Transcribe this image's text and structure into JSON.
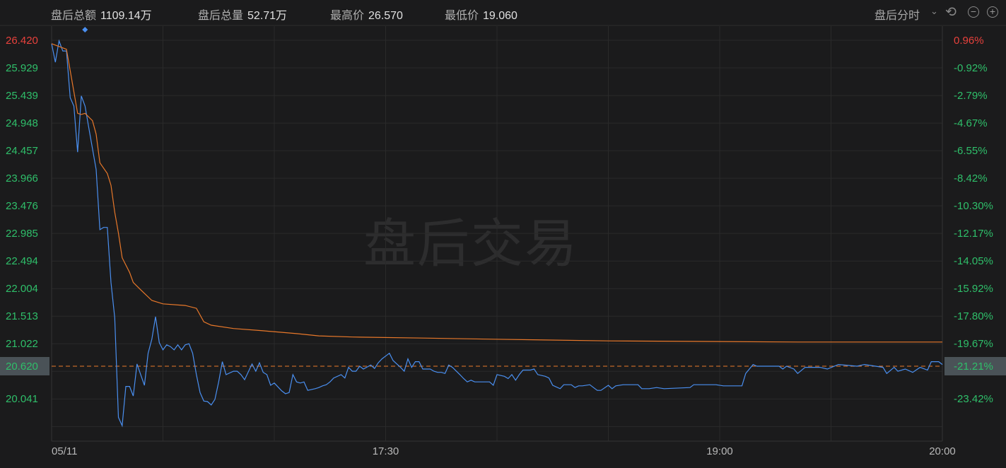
{
  "header": {
    "stats": [
      {
        "label": "盘后总额",
        "value": "1109.14万"
      },
      {
        "label": "盘后总量",
        "value": "52.71万"
      },
      {
        "label": "最高价",
        "value": "26.570"
      },
      {
        "label": "最低价",
        "value": "19.060"
      }
    ],
    "mode": "盘后分时",
    "icons": [
      "chevron-down-icon",
      "undo-icon",
      "zoom-out-icon",
      "zoom-in-icon"
    ]
  },
  "watermark": "盘后交易",
  "colors": {
    "price": "#4a8ff0",
    "avg": "#e8782a",
    "up": "#e8413c",
    "down": "#2fbf6a",
    "ref": "#e8782a"
  },
  "chart_data": {
    "type": "line",
    "title": "盘后分时",
    "xlabel": "",
    "ylabel": "",
    "x_unit": "minutes since 16:00",
    "xlim": [
      0,
      240
    ],
    "ylim": [
      19.286,
      26.672
    ],
    "grid": true,
    "x_ticks": [
      {
        "minute": 0,
        "label": "05/11"
      },
      {
        "minute": 90,
        "label": "17:30"
      },
      {
        "minute": 180,
        "label": "19:00"
      },
      {
        "minute": 240,
        "label": "20:00"
      }
    ],
    "y_ticks_left": [
      "26.420",
      "25.929",
      "25.439",
      "24.948",
      "24.457",
      "23.966",
      "23.476",
      "22.985",
      "22.494",
      "22.004",
      "21.513",
      "21.022",
      "20.620",
      "20.041"
    ],
    "y_ticks_left_values": [
      26.42,
      25.929,
      25.439,
      24.948,
      24.457,
      23.966,
      23.476,
      22.985,
      22.494,
      22.004,
      21.513,
      21.022,
      20.62,
      20.041
    ],
    "y_ticks_right": [
      "0.96%",
      "-0.92%",
      "-2.79%",
      "-4.67%",
      "-6.55%",
      "-8.42%",
      "-10.30%",
      "-12.17%",
      "-14.05%",
      "-15.92%",
      "-17.80%",
      "-19.67%",
      "-21.21%",
      "-23.42%"
    ],
    "reference_price": 20.62,
    "series": [
      {
        "name": "price",
        "points": [
          [
            0,
            26.36
          ],
          [
            1,
            26.03
          ],
          [
            2,
            26.41
          ],
          [
            3,
            26.23
          ],
          [
            4,
            26.23
          ],
          [
            5,
            25.4
          ],
          [
            6,
            25.25
          ],
          [
            7,
            24.43
          ],
          [
            8,
            25.43
          ],
          [
            9,
            25.25
          ],
          [
            10,
            24.87
          ],
          [
            12,
            24.12
          ],
          [
            13,
            23.05
          ],
          [
            14,
            23.09
          ],
          [
            15,
            23.09
          ],
          [
            16,
            22.11
          ],
          [
            17,
            21.48
          ],
          [
            18,
            19.71
          ],
          [
            19,
            19.56
          ],
          [
            20,
            20.26
          ],
          [
            21,
            20.26
          ],
          [
            22,
            20.09
          ],
          [
            23,
            20.66
          ],
          [
            24,
            20.47
          ],
          [
            25,
            20.28
          ],
          [
            26,
            20.85
          ],
          [
            27,
            21.1
          ],
          [
            28,
            21.5
          ],
          [
            29,
            21.04
          ],
          [
            30,
            20.91
          ],
          [
            31,
            21.0
          ],
          [
            32,
            20.97
          ],
          [
            33,
            20.91
          ],
          [
            34,
            21.0
          ],
          [
            35,
            20.91
          ],
          [
            36,
            21.0
          ],
          [
            37,
            21.02
          ],
          [
            38,
            20.85
          ],
          [
            39,
            20.47
          ],
          [
            40,
            20.15
          ],
          [
            41,
            20.0
          ],
          [
            42,
            19.99
          ],
          [
            43,
            19.93
          ],
          [
            44,
            20.03
          ],
          [
            45,
            20.34
          ],
          [
            46,
            20.7
          ],
          [
            47,
            20.47
          ],
          [
            49,
            20.53
          ],
          [
            50,
            20.53
          ],
          [
            51,
            20.47
          ],
          [
            52,
            20.38
          ],
          [
            54,
            20.66
          ],
          [
            55,
            20.53
          ],
          [
            56,
            20.68
          ],
          [
            57,
            20.51
          ],
          [
            58,
            20.47
          ],
          [
            59,
            20.28
          ],
          [
            60,
            20.32
          ],
          [
            62,
            20.18
          ],
          [
            63,
            20.13
          ],
          [
            64,
            20.15
          ],
          [
            65,
            20.47
          ],
          [
            66,
            20.34
          ],
          [
            67,
            20.32
          ],
          [
            68,
            20.34
          ],
          [
            69,
            20.19
          ],
          [
            71,
            20.22
          ],
          [
            72,
            20.24
          ],
          [
            73,
            20.27
          ],
          [
            74,
            20.29
          ],
          [
            75,
            20.34
          ],
          [
            76,
            20.41
          ],
          [
            78,
            20.47
          ],
          [
            79,
            20.41
          ],
          [
            80,
            20.6
          ],
          [
            81,
            20.53
          ],
          [
            82,
            20.53
          ],
          [
            83,
            20.62
          ],
          [
            84,
            20.57
          ],
          [
            86,
            20.64
          ],
          [
            87,
            20.58
          ],
          [
            88,
            20.68
          ],
          [
            89,
            20.75
          ],
          [
            90,
            20.8
          ],
          [
            91,
            20.85
          ],
          [
            92,
            20.72
          ],
          [
            94,
            20.6
          ],
          [
            95,
            20.53
          ],
          [
            96,
            20.75
          ],
          [
            97,
            20.6
          ],
          [
            98,
            20.7
          ],
          [
            99,
            20.7
          ],
          [
            100,
            20.57
          ],
          [
            102,
            20.57
          ],
          [
            103,
            20.53
          ],
          [
            104,
            20.51
          ],
          [
            105,
            20.51
          ],
          [
            106,
            20.49
          ],
          [
            107,
            20.64
          ],
          [
            108,
            20.6
          ],
          [
            110,
            20.47
          ],
          [
            111,
            20.4
          ],
          [
            112,
            20.34
          ],
          [
            113,
            20.37
          ],
          [
            114,
            20.34
          ],
          [
            118,
            20.34
          ],
          [
            119,
            20.28
          ],
          [
            120,
            20.47
          ],
          [
            122,
            20.44
          ],
          [
            123,
            20.4
          ],
          [
            124,
            20.47
          ],
          [
            125,
            20.37
          ],
          [
            126,
            20.47
          ],
          [
            127,
            20.55
          ],
          [
            129,
            20.55
          ],
          [
            130,
            20.57
          ],
          [
            131,
            20.47
          ],
          [
            133,
            20.44
          ],
          [
            134,
            20.41
          ],
          [
            135,
            20.28
          ],
          [
            137,
            20.22
          ],
          [
            138,
            20.29
          ],
          [
            140,
            20.29
          ],
          [
            141,
            20.24
          ],
          [
            142,
            20.27
          ],
          [
            143,
            20.27
          ],
          [
            145,
            20.29
          ],
          [
            146,
            20.24
          ],
          [
            147,
            20.19
          ],
          [
            148,
            20.19
          ],
          [
            150,
            20.28
          ],
          [
            151,
            20.22
          ],
          [
            152,
            20.27
          ],
          [
            154,
            20.29
          ],
          [
            158,
            20.29
          ],
          [
            159,
            20.22
          ],
          [
            161,
            20.22
          ],
          [
            163,
            20.24
          ],
          [
            165,
            20.22
          ],
          [
            172,
            20.24
          ],
          [
            173,
            20.29
          ],
          [
            179,
            20.29
          ],
          [
            181,
            20.27
          ],
          [
            186,
            20.27
          ],
          [
            187,
            20.49
          ],
          [
            189,
            20.65
          ],
          [
            190,
            20.62
          ],
          [
            196,
            20.62
          ],
          [
            197,
            20.57
          ],
          [
            198,
            20.62
          ],
          [
            200,
            20.57
          ],
          [
            201,
            20.49
          ],
          [
            203,
            20.6
          ],
          [
            207,
            20.6
          ],
          [
            209,
            20.57
          ],
          [
            212,
            20.65
          ],
          [
            217,
            20.62
          ],
          [
            219,
            20.65
          ],
          [
            222,
            20.62
          ],
          [
            224,
            20.6
          ],
          [
            225,
            20.49
          ],
          [
            227,
            20.6
          ],
          [
            228,
            20.53
          ],
          [
            230,
            20.57
          ],
          [
            232,
            20.51
          ],
          [
            234,
            20.6
          ],
          [
            236,
            20.55
          ],
          [
            237,
            20.7
          ],
          [
            239,
            20.7
          ],
          [
            240,
            20.65
          ]
        ]
      },
      {
        "name": "average",
        "points": [
          [
            0,
            26.36
          ],
          [
            4,
            26.26
          ],
          [
            5,
            25.88
          ],
          [
            7,
            25.12
          ],
          [
            8,
            25.1
          ],
          [
            9,
            25.12
          ],
          [
            11,
            24.99
          ],
          [
            12,
            24.75
          ],
          [
            13,
            24.24
          ],
          [
            15,
            24.05
          ],
          [
            16,
            23.84
          ],
          [
            17,
            23.36
          ],
          [
            18,
            22.99
          ],
          [
            19,
            22.55
          ],
          [
            21,
            22.29
          ],
          [
            22,
            22.11
          ],
          [
            24,
            21.98
          ],
          [
            27,
            21.79
          ],
          [
            30,
            21.73
          ],
          [
            36,
            21.7
          ],
          [
            39,
            21.65
          ],
          [
            41,
            21.41
          ],
          [
            43,
            21.35
          ],
          [
            49,
            21.29
          ],
          [
            57,
            21.25
          ],
          [
            66,
            21.2
          ],
          [
            72,
            21.16
          ],
          [
            81,
            21.14
          ],
          [
            100,
            21.12
          ],
          [
            119,
            21.1
          ],
          [
            150,
            21.07
          ],
          [
            176,
            21.06
          ],
          [
            201,
            21.05
          ],
          [
            240,
            21.05
          ]
        ]
      }
    ],
    "markers": [
      {
        "minute": 9,
        "type": "diamond"
      }
    ]
  }
}
